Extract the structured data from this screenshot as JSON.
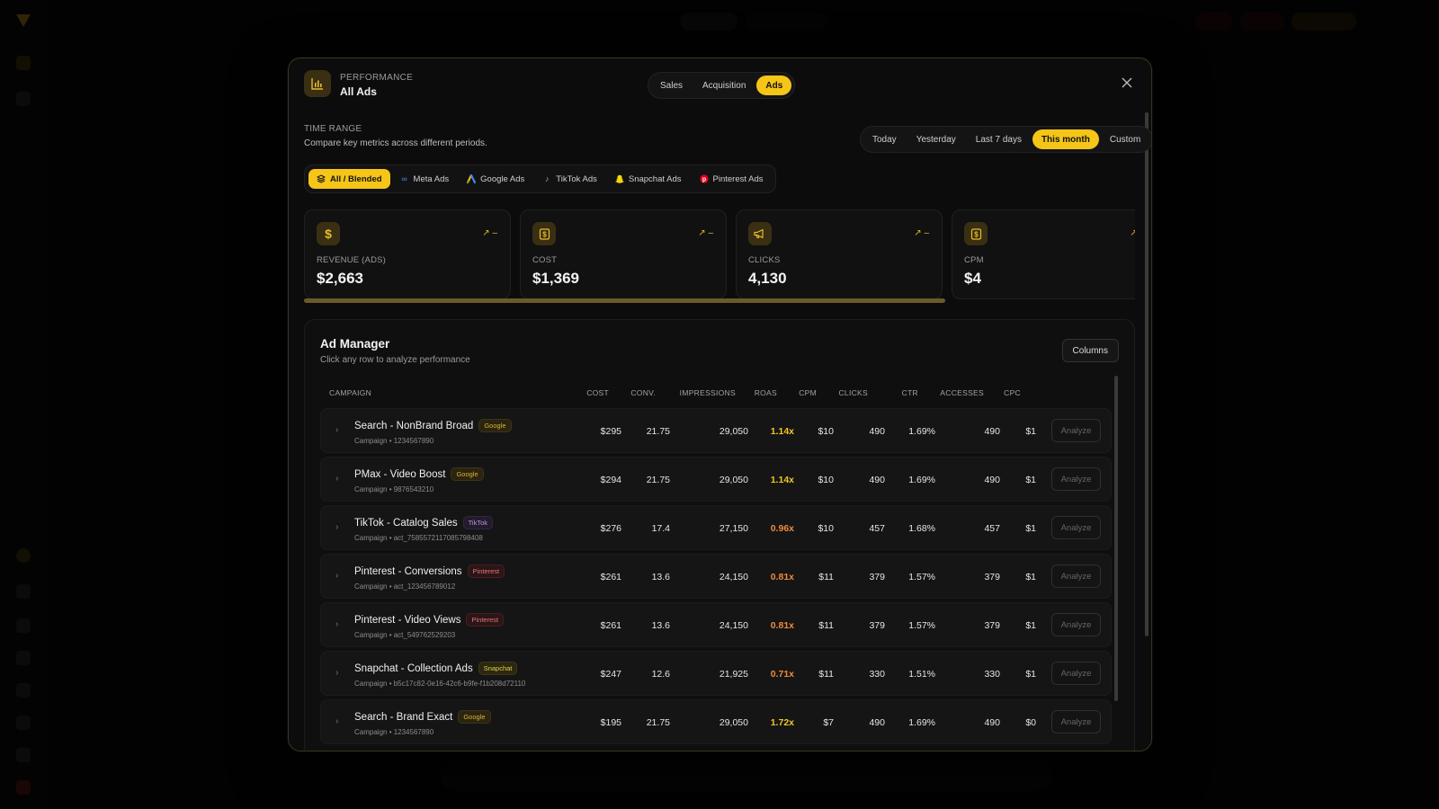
{
  "modal": {
    "eyebrow": "PERFORMANCE",
    "title": "All Ads",
    "tabs": [
      {
        "label": "Sales",
        "active": false
      },
      {
        "label": "Acquisition",
        "active": false
      },
      {
        "label": "Ads",
        "active": true
      }
    ]
  },
  "time_range": {
    "label": "TIME RANGE",
    "description": "Compare key metrics across different periods.",
    "options": [
      {
        "label": "Today",
        "active": false
      },
      {
        "label": "Yesterday",
        "active": false
      },
      {
        "label": "Last 7 days",
        "active": false
      },
      {
        "label": "This month",
        "active": true
      },
      {
        "label": "Custom",
        "active": false
      }
    ]
  },
  "platforms": [
    {
      "label": "All / Blended",
      "icon": "layers-icon",
      "active": true
    },
    {
      "label": "Meta Ads",
      "icon": "meta-icon",
      "active": false
    },
    {
      "label": "Google Ads",
      "icon": "google-ads-icon",
      "active": false
    },
    {
      "label": "TikTok Ads",
      "icon": "tiktok-icon",
      "active": false
    },
    {
      "label": "Snapchat Ads",
      "icon": "snapchat-icon",
      "active": false
    },
    {
      "label": "Pinterest Ads",
      "icon": "pinterest-icon",
      "active": false
    }
  ],
  "kpis": [
    {
      "label": "REVENUE (ADS)",
      "value": "$2,663",
      "icon": "dollar-icon",
      "trend": "↗ –"
    },
    {
      "label": "COST",
      "value": "$1,369",
      "icon": "receipt-icon",
      "trend": "↗ –"
    },
    {
      "label": "CLICKS",
      "value": "4,130",
      "icon": "megaphone-icon",
      "trend": "↗ –"
    },
    {
      "label": "CPM",
      "value": "$4",
      "icon": "receipt-icon",
      "trend": "↗ –"
    }
  ],
  "ad_manager": {
    "title": "Ad Manager",
    "subtitle": "Click any row to analyze performance",
    "columns_button": "Columns",
    "headers": {
      "campaign": "CAMPAIGN",
      "cost": "COST",
      "conv": "CONV.",
      "impressions": "IMPRESSIONS",
      "roas": "ROAS",
      "cpm": "CPM",
      "clicks": "CLICKS",
      "ctr": "CTR",
      "accesses": "ACCESSES",
      "cpc": "CPC"
    },
    "rows": [
      {
        "name": "Search - NonBrand Broad",
        "platform": "Google",
        "badge": "google",
        "sub": "Campaign • 1234567890",
        "cost": "$295",
        "conv": "21.75",
        "impressions": "29,050",
        "roas": "1.14x",
        "roas_color": "#f2c523",
        "cpm": "$10",
        "clicks": "490",
        "ctr": "1.69%",
        "accesses": "490",
        "cpc": "$1",
        "action": "Analyze"
      },
      {
        "name": "PMax - Video Boost",
        "platform": "Google",
        "badge": "google",
        "sub": "Campaign • 9876543210",
        "cost": "$294",
        "conv": "21.75",
        "impressions": "29,050",
        "roas": "1.14x",
        "roas_color": "#f2c523",
        "cpm": "$10",
        "clicks": "490",
        "ctr": "1.69%",
        "accesses": "490",
        "cpc": "$1",
        "action": "Analyze"
      },
      {
        "name": "TikTok - Catalog Sales",
        "platform": "TikTok",
        "badge": "tiktok",
        "sub": "Campaign • act_7585572117085798408",
        "cost": "$276",
        "conv": "17.4",
        "impressions": "27,150",
        "roas": "0.96x",
        "roas_color": "#ef8a3a",
        "cpm": "$10",
        "clicks": "457",
        "ctr": "1.68%",
        "accesses": "457",
        "cpc": "$1",
        "action": "Analyze"
      },
      {
        "name": "Pinterest - Conversions",
        "platform": "Pinterest",
        "badge": "pinterest",
        "sub": "Campaign • act_123456789012",
        "cost": "$261",
        "conv": "13.6",
        "impressions": "24,150",
        "roas": "0.81x",
        "roas_color": "#ef8a3a",
        "cpm": "$11",
        "clicks": "379",
        "ctr": "1.57%",
        "accesses": "379",
        "cpc": "$1",
        "action": "Analyze"
      },
      {
        "name": "Pinterest - Video Views",
        "platform": "Pinterest",
        "badge": "pinterest",
        "sub": "Campaign • act_549762529203",
        "cost": "$261",
        "conv": "13.6",
        "impressions": "24,150",
        "roas": "0.81x",
        "roas_color": "#ef8a3a",
        "cpm": "$11",
        "clicks": "379",
        "ctr": "1.57%",
        "accesses": "379",
        "cpc": "$1",
        "action": "Analyze"
      },
      {
        "name": "Snapchat - Collection Ads",
        "platform": "Snapchat",
        "badge": "snapchat",
        "sub": "Campaign • b5c17c82-0e16-42c6-b9fe-f1b208d72110",
        "cost": "$247",
        "conv": "12.6",
        "impressions": "21,925",
        "roas": "0.71x",
        "roas_color": "#ef8a3a",
        "cpm": "$11",
        "clicks": "330",
        "ctr": "1.51%",
        "accesses": "330",
        "cpc": "$1",
        "action": "Analyze"
      },
      {
        "name": "Search - Brand Exact",
        "platform": "Google",
        "badge": "google",
        "sub": "Campaign • 1234567890",
        "cost": "$195",
        "conv": "21.75",
        "impressions": "29,050",
        "roas": "1.72x",
        "roas_color": "#f2c523",
        "cpm": "$7",
        "clicks": "490",
        "ctr": "1.69%",
        "accesses": "490",
        "cpc": "$0",
        "action": "Analyze"
      }
    ]
  },
  "colors": {
    "accent": "#f5c518",
    "background": "#050505",
    "modal": "#0c0c0c",
    "roas_good": "#f2c523",
    "roas_low": "#ef8a3a"
  }
}
